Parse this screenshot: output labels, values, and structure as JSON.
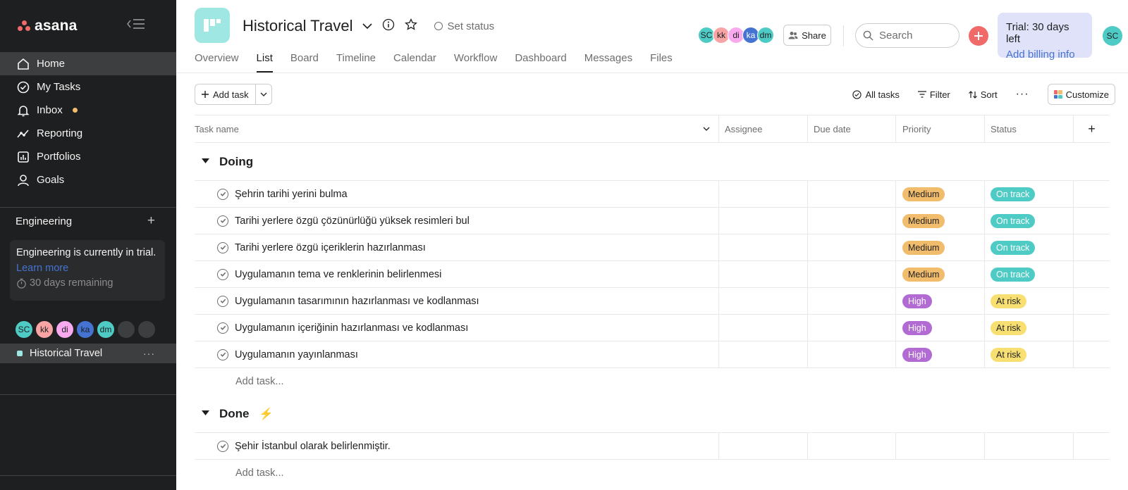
{
  "app": {
    "brand": "asana"
  },
  "sidebar": {
    "nav": [
      {
        "label": "Home",
        "icon": "home-icon"
      },
      {
        "label": "My Tasks",
        "icon": "check-circle-icon"
      },
      {
        "label": "Inbox",
        "icon": "bell-icon"
      },
      {
        "label": "Reporting",
        "icon": "reporting-icon"
      },
      {
        "label": "Portfolios",
        "icon": "portfolio-icon"
      },
      {
        "label": "Goals",
        "icon": "goals-icon"
      }
    ],
    "team": {
      "name": "Engineering",
      "add": "+"
    },
    "trial": {
      "title": "Engineering is currently in trial.",
      "link": "Learn more",
      "remaining": "30 days remaining"
    },
    "members": [
      {
        "initials": "SC",
        "color": "#4ecbc4"
      },
      {
        "initials": "kk",
        "color": "#f8a4a5"
      },
      {
        "initials": "di",
        "color": "#f9aaef"
      },
      {
        "initials": "ka",
        "color": "#4573d2"
      },
      {
        "initials": "dm",
        "color": "#4ecbc4"
      },
      {
        "initials": "",
        "color": "#3d3e40"
      },
      {
        "initials": "",
        "color": "#3d3e40"
      }
    ],
    "project": {
      "name": "Historical Travel",
      "more": "···"
    }
  },
  "header": {
    "title": "Historical Travel",
    "set_status": "Set status",
    "tabs": [
      "Overview",
      "List",
      "Board",
      "Timeline",
      "Calendar",
      "Workflow",
      "Dashboard",
      "Messages",
      "Files"
    ],
    "active_tab": "List",
    "share": "Share",
    "search_placeholder": "Search",
    "trial_card": {
      "line1": "Trial: 30 days left",
      "line2": "Add billing info"
    },
    "me": "SC"
  },
  "toolbar": {
    "add_task": "Add task",
    "all_tasks": "All tasks",
    "filter": "Filter",
    "sort": "Sort",
    "more": "···",
    "customize": "Customize"
  },
  "table": {
    "columns": [
      "Task name",
      "Assignee",
      "Due date",
      "Priority",
      "Status"
    ],
    "add_column": "+",
    "add_task_label": "Add task...",
    "sections": [
      {
        "name": "Doing",
        "emoji": "",
        "tasks": [
          {
            "name": "Şehrin tarihi yerini bulma",
            "priority": "Medium",
            "status": "On track"
          },
          {
            "name": "Tarihi yerlere özgü çözünürlüğü yüksek resimleri bul",
            "priority": "Medium",
            "status": "On track"
          },
          {
            "name": "Tarihi  yerlere özgü içeriklerin hazırlanması",
            "priority": "Medium",
            "status": "On track"
          },
          {
            "name": "Uygulamanın tema ve renklerinin belirlenmesi",
            "priority": "Medium",
            "status": "On track"
          },
          {
            "name": "Uygulamanın tasarımının hazırlanması ve kodlanması",
            "priority": "High",
            "status": "At risk"
          },
          {
            "name": "Uygulamanın içeriğinin hazırlanması ve kodlanması",
            "priority": "High",
            "status": "At risk"
          },
          {
            "name": "Uygulamanın yayınlanması",
            "priority": "High",
            "status": "At risk"
          }
        ]
      },
      {
        "name": "Done",
        "emoji": "⚡",
        "tasks": [
          {
            "name": "Şehir İstanbul olarak belirlenmiştir.",
            "priority": "",
            "status": ""
          }
        ]
      }
    ]
  },
  "colors": {
    "Medium": "#f1bd6c",
    "High": "#b36bd4",
    "On track": "#4ecbc4",
    "At risk": "#f8df72"
  }
}
